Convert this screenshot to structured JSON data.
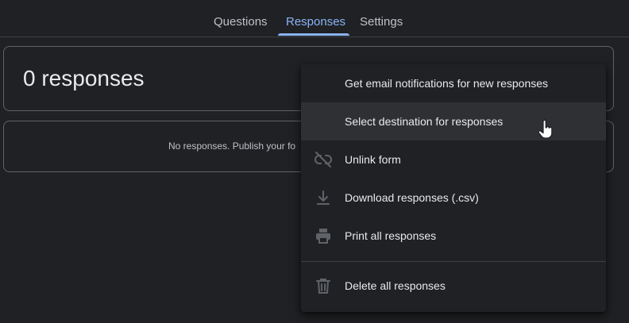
{
  "tabs": [
    {
      "label": "Questions"
    },
    {
      "label": "Responses"
    },
    {
      "label": "Settings"
    }
  ],
  "active_tab": "Responses",
  "summary": {
    "title": "0 responses"
  },
  "empty_state": {
    "text": "No responses. Publish your fo"
  },
  "menu": {
    "items": [
      {
        "label": "Get email notifications for new responses",
        "icon": "none"
      },
      {
        "label": "Select destination for responses",
        "icon": "none",
        "hovered": true
      },
      {
        "label": "Unlink form",
        "icon": "link-off-icon"
      },
      {
        "label": "Download responses (.csv)",
        "icon": "download-icon"
      },
      {
        "label": "Print all responses",
        "icon": "print-icon"
      },
      {
        "label": "Delete all responses",
        "icon": "trash-icon"
      }
    ]
  },
  "colors": {
    "background": "#202124",
    "accent": "#8ab4f8",
    "text": "#e8eaed",
    "muted_icon": "#5f6368"
  }
}
